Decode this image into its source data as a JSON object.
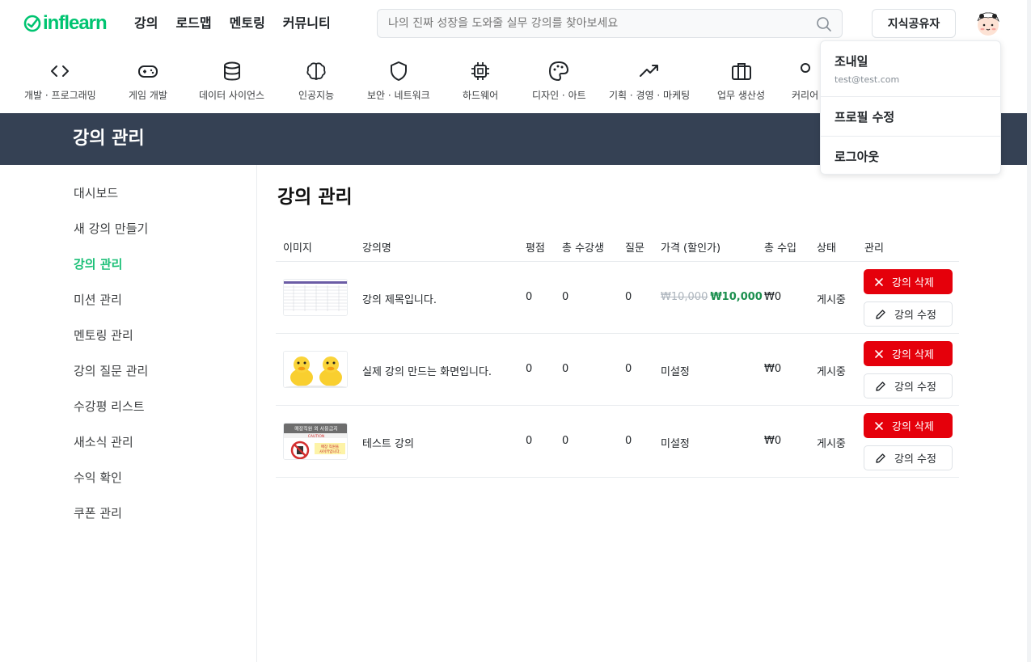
{
  "header": {
    "logo_text": "inflearn",
    "nav": [
      "강의",
      "로드맵",
      "멘토링",
      "커뮤니티"
    ],
    "search_placeholder": "나의 진짜 성장을 도와줄 실무 강의를 찾아보세요",
    "share_button": "지식공유자"
  },
  "categories": [
    {
      "label": "개발 · 프로그래밍",
      "icon": "code-icon"
    },
    {
      "label": "게임 개발",
      "icon": "gamepad-icon"
    },
    {
      "label": "데이터 사이언스",
      "icon": "database-icon"
    },
    {
      "label": "인공지능",
      "icon": "brain-icon"
    },
    {
      "label": "보안 · 네트워크",
      "icon": "shield-icon"
    },
    {
      "label": "하드웨어",
      "icon": "chip-icon"
    },
    {
      "label": "디자인 · 아트",
      "icon": "palette-icon"
    },
    {
      "label": "기획 · 경영 · 마케팅",
      "icon": "trending-up-icon"
    },
    {
      "label": "업무 생산성",
      "icon": "briefcase-icon"
    },
    {
      "label": "커리어",
      "icon": "career-icon"
    }
  ],
  "page_banner_title": "강의 관리",
  "sidebar": {
    "items": [
      {
        "label": "대시보드"
      },
      {
        "label": "새 강의 만들기"
      },
      {
        "label": "강의 관리"
      },
      {
        "label": "미션 관리"
      },
      {
        "label": "멘토링 관리"
      },
      {
        "label": "강의 질문 관리"
      },
      {
        "label": "수강평 리스트"
      },
      {
        "label": "새소식 관리"
      },
      {
        "label": "수익 확인"
      },
      {
        "label": "쿠폰 관리"
      }
    ],
    "active_index": 2
  },
  "main": {
    "title": "강의 관리",
    "columns": [
      "이미지",
      "강의명",
      "평점",
      "총 수강생",
      "질문",
      "가격 (할인가)",
      "총 수입",
      "상태",
      "관리"
    ],
    "rows": [
      {
        "name": "강의 제목입니다.",
        "rating": "0",
        "students": "0",
        "questions": "0",
        "price_original": "₩10,000",
        "price_sale": "₩10,000",
        "price_text": "",
        "revenue": "₩0",
        "status": "게시중",
        "thumb": "spreadsheet"
      },
      {
        "name": "실제 강의 만드는 화면입니다.",
        "rating": "0",
        "students": "0",
        "questions": "0",
        "price_original": "",
        "price_sale": "",
        "price_text": "미설정",
        "revenue": "₩0",
        "status": "게시중",
        "thumb": "ducks"
      },
      {
        "name": "테스트 강의",
        "rating": "0",
        "students": "0",
        "questions": "0",
        "price_original": "",
        "price_sale": "",
        "price_text": "미설정",
        "revenue": "₩0",
        "status": "게시중",
        "thumb": "sign"
      }
    ],
    "delete_label": "강의 삭제",
    "edit_label": "강의 수정"
  },
  "dropdown": {
    "name": "조내일",
    "email": "test@test.com",
    "profile_edit": "프로필 수정",
    "logout": "로그아웃"
  },
  "thumb_sign": {
    "header": "매장직원 외 사용금지",
    "caution": "CAUTION",
    "line1": "매장 직원을",
    "line2": "사이키입니다."
  },
  "colors": {
    "brand": "#00c471",
    "banner": "#354154",
    "danger": "#e5000b",
    "sale": "#1b8f4e"
  }
}
